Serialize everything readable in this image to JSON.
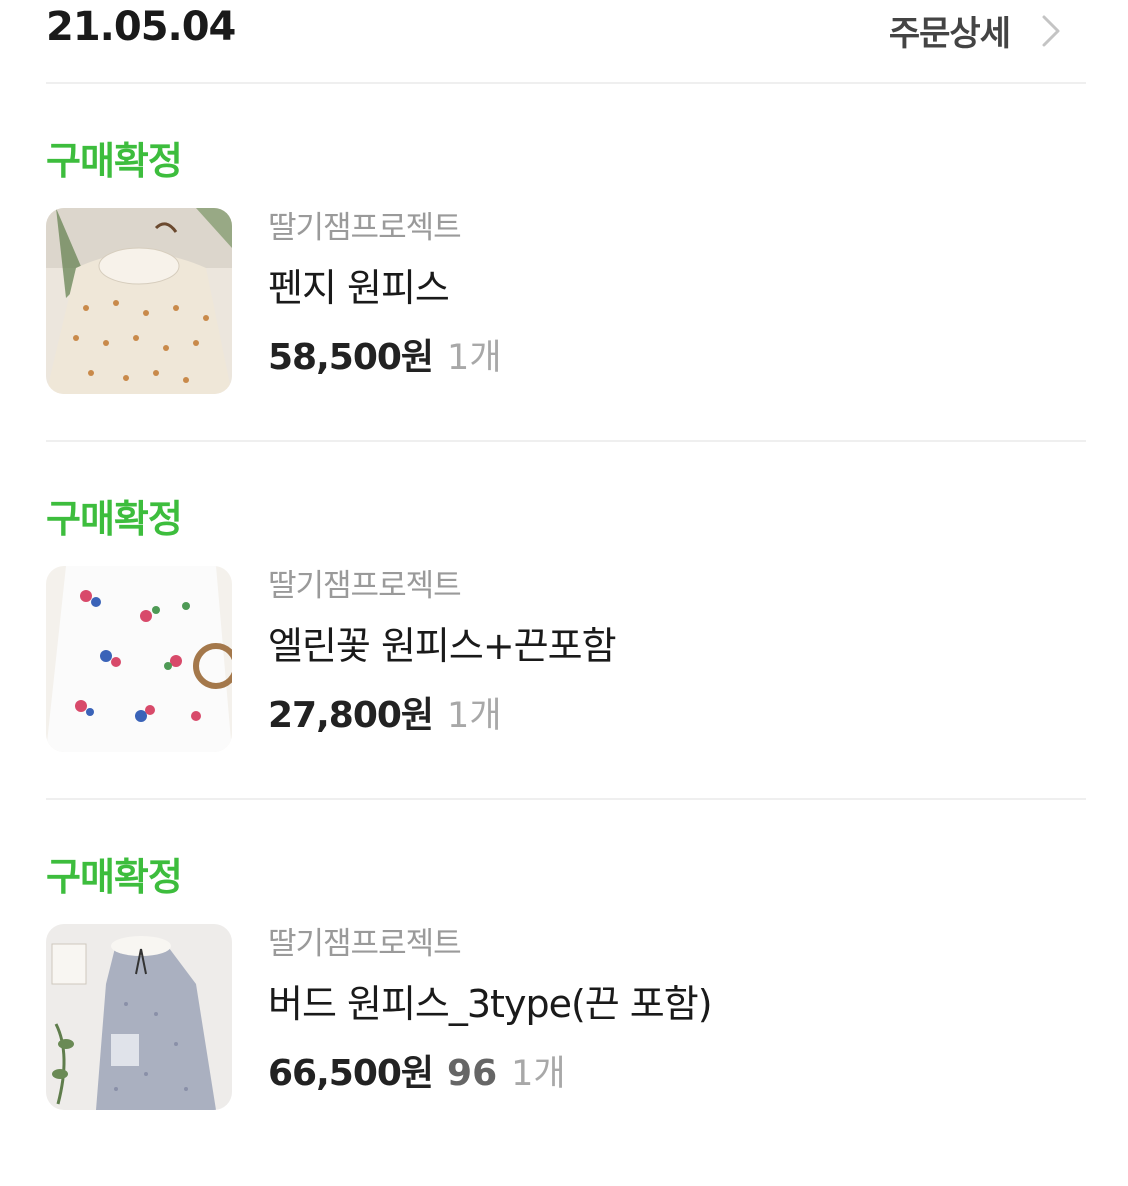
{
  "header": {
    "date": "21.05.04",
    "detail_label": "주문상세"
  },
  "orders": [
    {
      "status": "구매확정",
      "seller": "딸기잼프로젝트",
      "product_name": "펜지 원피스",
      "price": "58,500원",
      "extra": "",
      "quantity": "1개"
    },
    {
      "status": "구매확정",
      "seller": "딸기잼프로젝트",
      "product_name": "엘린꽃 원피스+끈포함",
      "price": "27,800원",
      "extra": "",
      "quantity": "1개"
    },
    {
      "status": "구매확정",
      "seller": "딸기잼프로젝트",
      "product_name": "버드 원피스_3type(끈 포함)",
      "price": "66,500원",
      "extra": "96",
      "quantity": "1개"
    }
  ],
  "colors": {
    "status_green": "#3dbd3d",
    "seller_gray": "#9a9a9a",
    "divider": "#efefef"
  },
  "icons": {
    "detail_chevron": "chevron-right-icon"
  }
}
